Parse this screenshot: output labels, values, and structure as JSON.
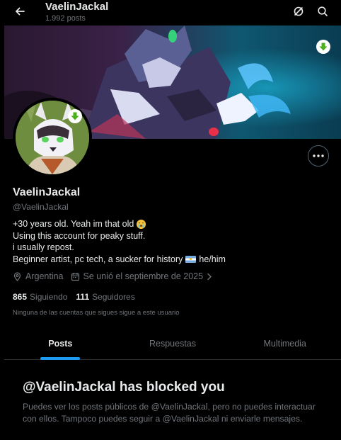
{
  "header": {
    "title": "VaelinJackal",
    "post_count": "1.992 posts"
  },
  "icons": {
    "back": "arrow-left-icon",
    "grok": "grok-icon",
    "search": "search-icon",
    "more": "more-horizontal-icon",
    "download": "download-arrow-icon",
    "location": "location-pin-icon",
    "calendar": "calendar-icon",
    "chevron": "chevron-right-icon"
  },
  "colors": {
    "accent": "#1d9bf0",
    "download_badge": "#4caf1c",
    "muted": "#71767b"
  },
  "profile": {
    "name": "VaelinJackal",
    "handle": "@VaelinJackal",
    "bio": {
      "line1": "+30 years old. Yeah im that old",
      "line2": "Using this account for peaky stuff.",
      "line3": "i usually repost.",
      "line4": "Beginner artist, pc tech, a sucker for history",
      "line4_suffix": "he/him"
    },
    "location": "Argentina",
    "joined": "Se unió el septiembre de 2025",
    "following_count": "865",
    "following_label": "Siguiendo",
    "followers_count": "111",
    "followers_label": "Seguidores",
    "no_followers_note": "Ninguna de las cuentas que sigues sigue a este usuario"
  },
  "tabs": [
    {
      "label": "Posts",
      "active": true
    },
    {
      "label": "Respuestas",
      "active": false
    },
    {
      "label": "Multimedia",
      "active": false
    }
  ],
  "blocked": {
    "title": "@VaelinJackal has blocked you",
    "message": "Puedes ver los posts públicos de @VaelinJackal, pero no puedes interactuar con ellos. Tampoco puedes seguir a @VaelinJackal ni enviarle mensajes."
  }
}
